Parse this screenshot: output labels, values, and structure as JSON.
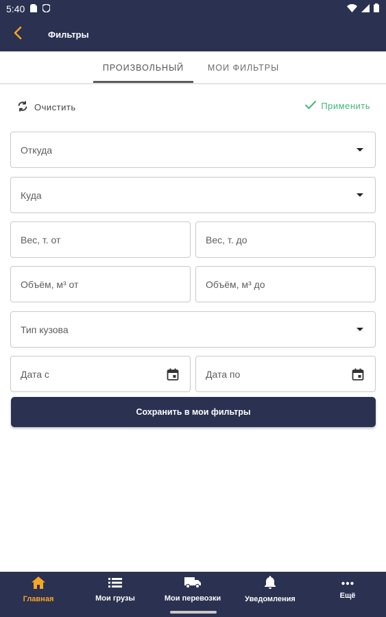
{
  "status_bar": {
    "time": "5:40"
  },
  "app_bar": {
    "title": "Фильтры"
  },
  "tabs": [
    {
      "label": "ПРОИЗВОЛЬНЫЙ",
      "active": true
    },
    {
      "label": "МОИ ФИЛЬТРЫ",
      "active": false
    }
  ],
  "actions": {
    "clear_label": "Очистить",
    "apply_label": "Применить"
  },
  "form": {
    "from_placeholder": "Откуда",
    "to_placeholder": "Куда",
    "weight_from_placeholder": "Вес, т. от",
    "weight_to_placeholder": "Вес, т. до",
    "volume_from_placeholder": "Объём, м³ от",
    "volume_to_placeholder": "Объём, м³ до",
    "body_type_placeholder": "Тип кузова",
    "date_from_placeholder": "Дата с",
    "date_to_placeholder": "Дата по",
    "save_label": "Сохранить в мои фильтры"
  },
  "bottom_nav": [
    {
      "label": "Главная",
      "icon": "home-icon",
      "active": true
    },
    {
      "label": "Мои грузы",
      "icon": "list-icon",
      "active": false
    },
    {
      "label": "Мои перевозки",
      "icon": "truck-icon",
      "active": false
    },
    {
      "label": "Уведомления",
      "icon": "bell-icon",
      "active": false
    },
    {
      "label": "Ещё",
      "icon": "more-icon",
      "active": false
    }
  ],
  "colors": {
    "primary": "#2b3150",
    "accent": "#f5a623",
    "apply": "#3cb879"
  }
}
